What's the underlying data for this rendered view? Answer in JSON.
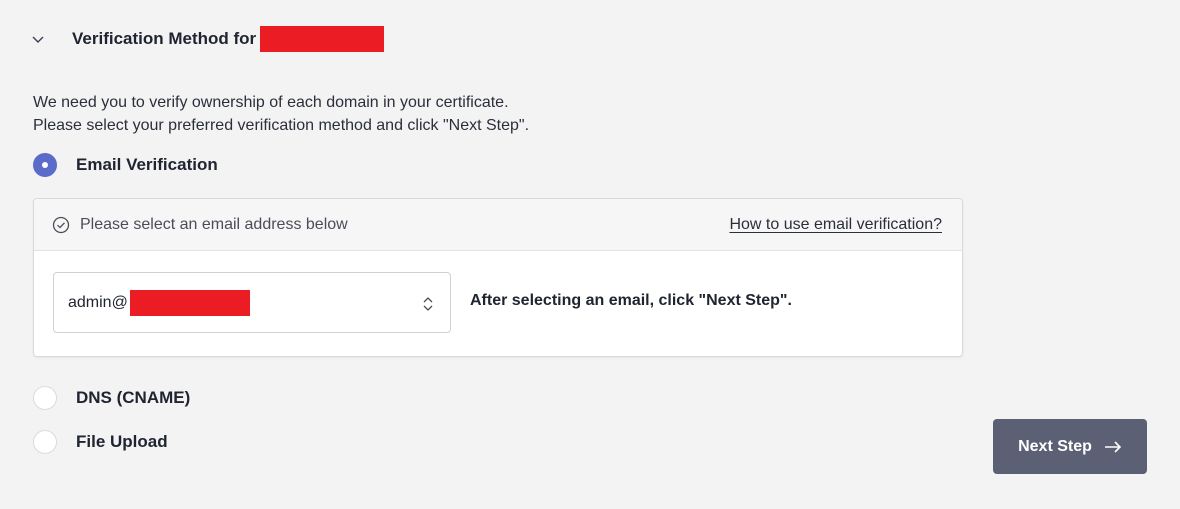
{
  "section": {
    "title": "Verification Method for",
    "icon": "chevron-down-icon"
  },
  "intro": {
    "line1": "We need you to verify ownership of each domain in your certificate.",
    "line2": "Please select your preferred verification method and click \"Next Step\"."
  },
  "methods": [
    {
      "label": "Email Verification",
      "selected": true
    },
    {
      "label": "DNS (CNAME)",
      "selected": false
    },
    {
      "label": "File Upload",
      "selected": false
    }
  ],
  "email_panel": {
    "hint": "Please select an email address below",
    "hint_icon": "check-circle-icon",
    "help_link": "How to use email verification?",
    "selected_email_prefix": "admin@",
    "select_icon": "up-down-chevron-icon",
    "instruction": "After selecting an email, click \"Next Step\"."
  },
  "actions": {
    "next_label": "Next Step",
    "next_icon": "arrow-right-icon"
  },
  "colors": {
    "accent": "#5b6bc9",
    "button_bg": "#5b6074",
    "redaction": "#ec1c24",
    "page_bg": "#f3f3f4"
  }
}
